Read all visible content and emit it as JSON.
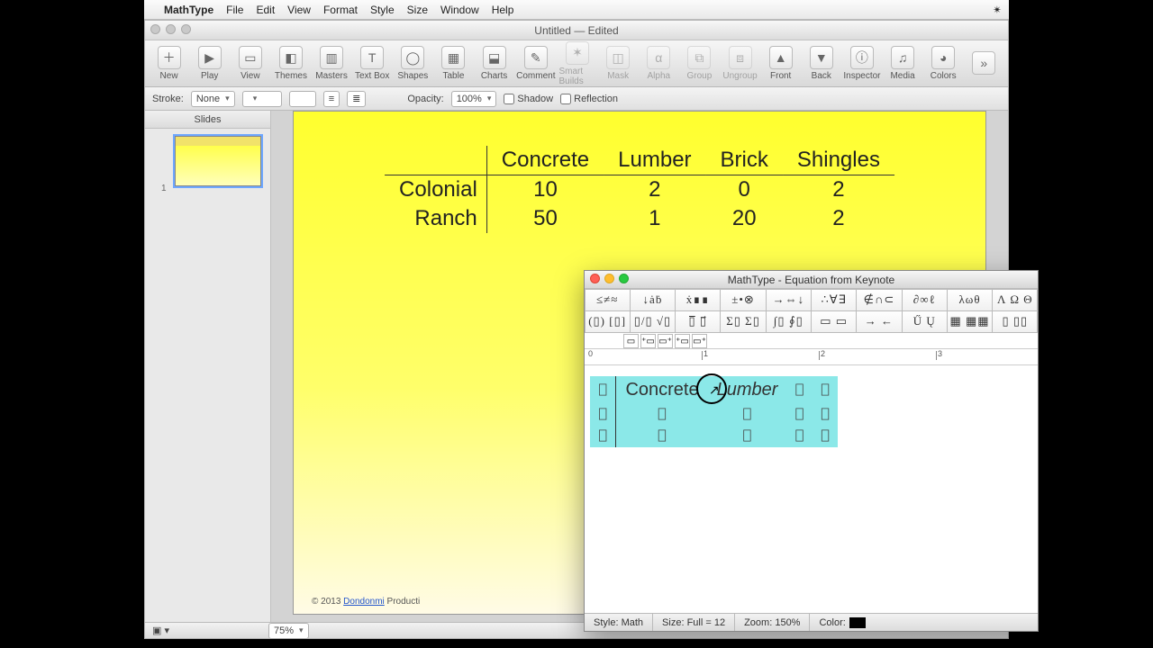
{
  "menubar": {
    "appname": "MathType",
    "items": [
      "File",
      "Edit",
      "View",
      "Format",
      "Style",
      "Size",
      "Window",
      "Help"
    ]
  },
  "keynote": {
    "title": "Untitled — Edited",
    "toolbar": [
      {
        "label": "New",
        "icon": "＋",
        "name": "new-button"
      },
      {
        "label": "Play",
        "icon": "▶",
        "name": "play-button"
      },
      {
        "label": "View",
        "icon": "▭",
        "name": "view-button"
      },
      {
        "label": "Themes",
        "icon": "◧",
        "name": "themes-button"
      },
      {
        "label": "Masters",
        "icon": "▥",
        "name": "masters-button"
      },
      {
        "label": "Text Box",
        "icon": "T",
        "name": "textbox-button"
      },
      {
        "label": "Shapes",
        "icon": "◯",
        "name": "shapes-button"
      },
      {
        "label": "Table",
        "icon": "▦",
        "name": "table-button"
      },
      {
        "label": "Charts",
        "icon": "⬓",
        "name": "charts-button"
      },
      {
        "label": "Comment",
        "icon": "✎",
        "name": "comment-button"
      },
      {
        "label": "Smart Builds",
        "icon": "✶",
        "name": "smartbuilds-button",
        "dim": true
      },
      {
        "label": "Mask",
        "icon": "◫",
        "name": "mask-button",
        "dim": true
      },
      {
        "label": "Alpha",
        "icon": "α",
        "name": "alpha-button",
        "dim": true
      },
      {
        "label": "Group",
        "icon": "⧉",
        "name": "group-button",
        "dim": true
      },
      {
        "label": "Ungroup",
        "icon": "⧈",
        "name": "ungroup-button",
        "dim": true
      },
      {
        "label": "Front",
        "icon": "▲",
        "name": "front-button"
      },
      {
        "label": "Back",
        "icon": "▼",
        "name": "back-button"
      },
      {
        "label": "Inspector",
        "icon": "ⓘ",
        "name": "inspector-button"
      },
      {
        "label": "Media",
        "icon": "♫",
        "name": "media-button"
      },
      {
        "label": "Colors",
        "icon": "◕",
        "name": "colors-button"
      }
    ],
    "format": {
      "stroke_label": "Stroke:",
      "stroke_value": "None",
      "opacity_label": "Opacity:",
      "opacity_value": "100%",
      "shadow_label": "Shadow",
      "reflection_label": "Reflection"
    },
    "sidebar_header": "Slides",
    "slide_number": "1",
    "copyright": "© 2013 ",
    "copyright_link": "Dondonmi",
    "copyright_suffix": " Producti",
    "status_zoom": "75%"
  },
  "slide_table": {
    "cols": [
      "Concrete",
      "Lumber",
      "Brick",
      "Shingles"
    ],
    "rows": [
      {
        "label": "Colonial",
        "vals": [
          "10",
          "2",
          "0",
          "2"
        ]
      },
      {
        "label": "Ranch",
        "vals": [
          "50",
          "1",
          "20",
          "2"
        ]
      }
    ]
  },
  "mathtype": {
    "title": "MathType - Equation from Keynote",
    "palette_row1": [
      "≤≠≈",
      "↓ȧḃ",
      "ẋ∎∎",
      "±•⊗",
      "→⇔↓",
      "∴∀∃",
      "∉∩⊂",
      "∂∞ℓ",
      "λωθ",
      "Λ Ω Θ"
    ],
    "palette_row2": [
      "(▯) [▯]",
      "▯/▯ √▯",
      "▯̅ ▯⃗",
      "Σ▯ Σ▯",
      "∫▯ ∮▯",
      "▭ ▭",
      "→ ←",
      "Ű Ų",
      "▦ ▦▦",
      "▯ ▯▯"
    ],
    "small_tabs": [
      "▭",
      "⁺▭",
      "▭⁺",
      "⁺▭",
      "▭⁺"
    ],
    "edit": {
      "cells": [
        "Concrete",
        "Lumber"
      ]
    },
    "status": {
      "style_label": "Style:",
      "style": "Math",
      "size_label": "Size:",
      "size": "Full = 12",
      "zoom_label": "Zoom:",
      "zoom": "150%",
      "color_label": "Color:"
    }
  },
  "chart_data": {
    "type": "table",
    "title": "",
    "columns": [
      "",
      "Concrete",
      "Lumber",
      "Brick",
      "Shingles"
    ],
    "rows": [
      [
        "Colonial",
        10,
        2,
        0,
        2
      ],
      [
        "Ranch",
        50,
        1,
        20,
        2
      ]
    ]
  }
}
